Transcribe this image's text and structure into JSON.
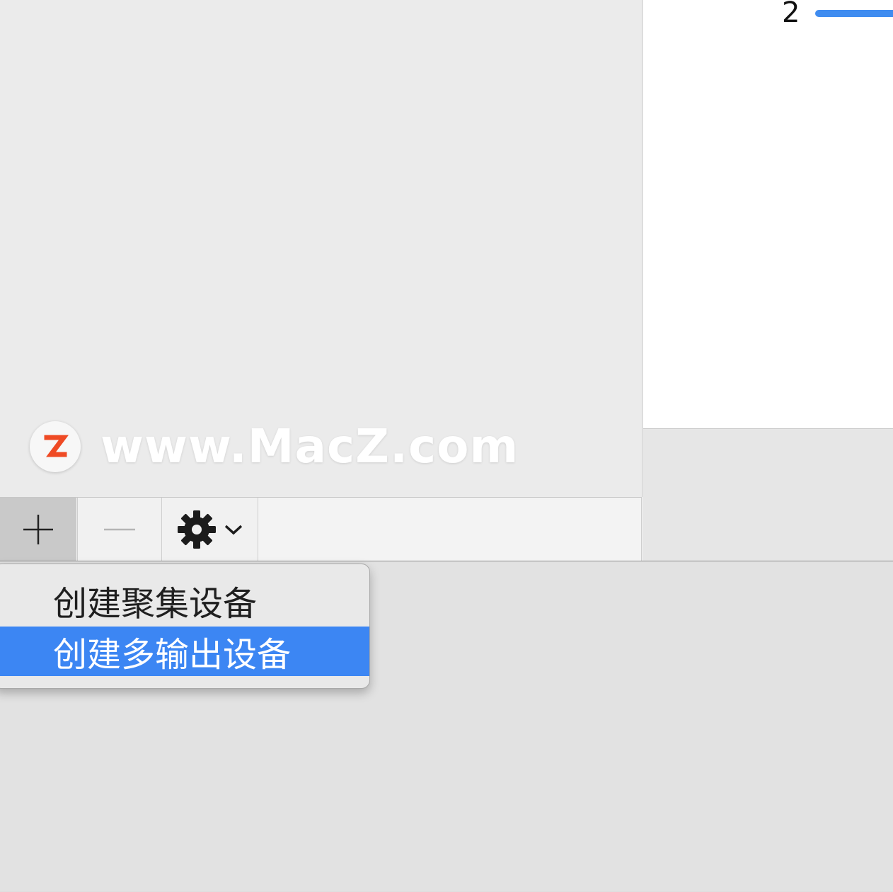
{
  "detail": {
    "channel_number": "2",
    "volume_color": "#3f8cf0"
  },
  "watermark": {
    "text": "www.MacZ.com",
    "logo_letter": "Z",
    "logo_color": "#ef4a24"
  },
  "toolbar": {
    "add_symbol": "+",
    "remove_symbol": "—",
    "settings_icon": "gear-icon",
    "dropdown_icon": "chevron-down-icon"
  },
  "menu": {
    "items": [
      {
        "label": "创建聚集设备",
        "selected": false
      },
      {
        "label": "创建多输出设备",
        "selected": true
      }
    ],
    "highlight_color": "#3c86f3"
  }
}
